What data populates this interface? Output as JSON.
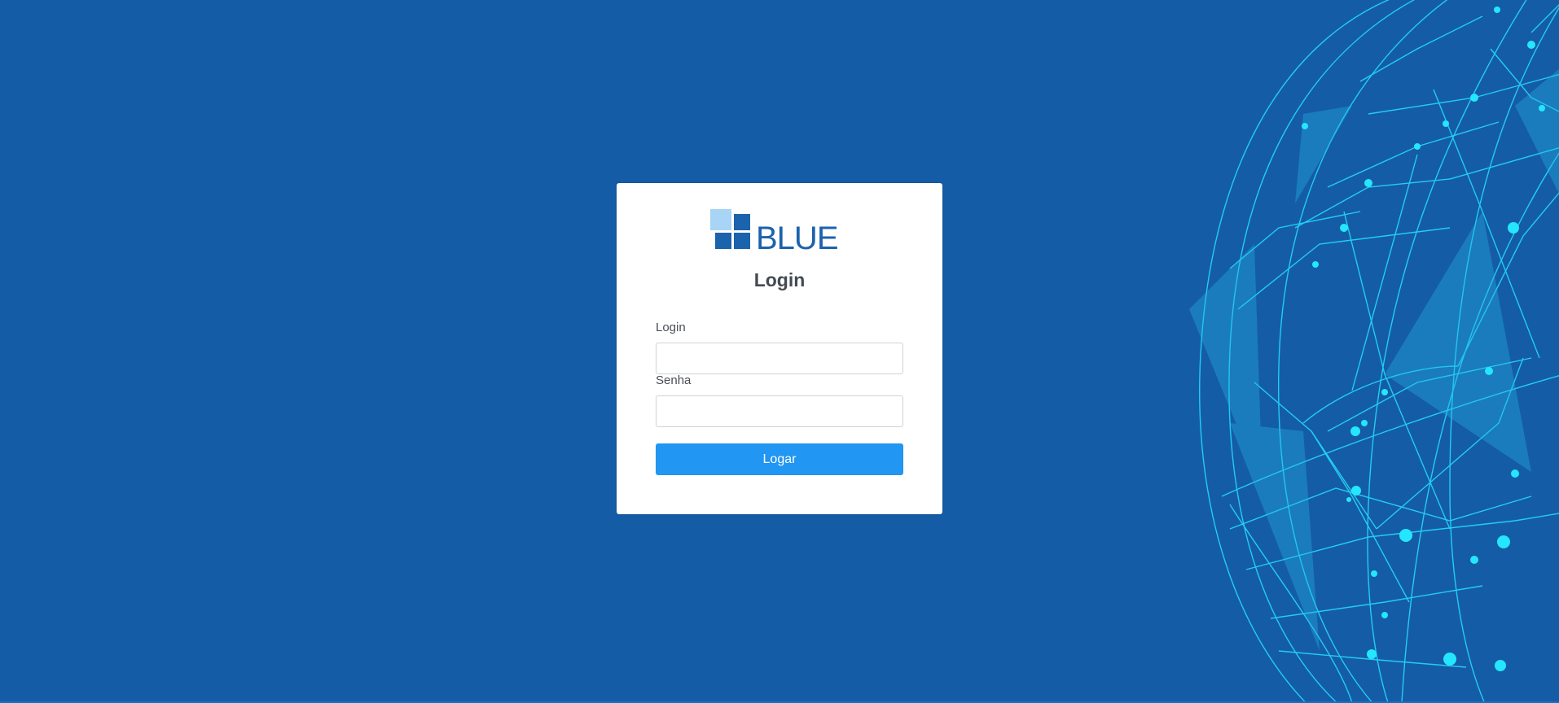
{
  "brand": {
    "name": "BLUE",
    "colors": {
      "background": "#155ca6",
      "logo_light": "#a8d4f5",
      "logo_dark": "#1b63ac",
      "button": "#2196f3",
      "globe": "#1fe0ff"
    }
  },
  "card": {
    "title": "Login"
  },
  "form": {
    "login_label": "Login",
    "login_value": "",
    "password_label": "Senha",
    "password_value": "",
    "submit_label": "Logar"
  }
}
